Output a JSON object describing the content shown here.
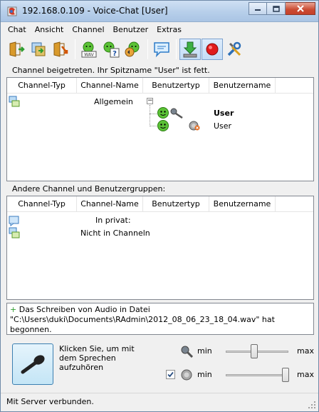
{
  "window": {
    "title": "192.168.0.109 - Voice-Chat [User]"
  },
  "menu": {
    "items": [
      "Chat",
      "Ansicht",
      "Channel",
      "Benutzer",
      "Extras"
    ]
  },
  "toolbar": {
    "buttons": [
      "join-channel-icon",
      "move-icon",
      "leave-icon",
      "user-wav-icon",
      "user-help-icon",
      "user-sound-icon",
      "chat-message-icon",
      "download-icon",
      "record-icon",
      "tools-icon"
    ]
  },
  "status_message": "Channel beigetreten. Ihr Spitzname \"User\" ist fett.",
  "channel_list": {
    "columns": [
      "Channel-Typ",
      "Channel-Name",
      "Benutzertyp",
      "Benutzername"
    ],
    "channel": {
      "name": "Allgemein",
      "expand_symbol": "−"
    },
    "users": [
      {
        "name": "User",
        "bold": true
      },
      {
        "name": "User",
        "bold": false
      }
    ]
  },
  "other_section": {
    "label": "Andere Channel und Benutzergruppen:",
    "columns": [
      "Channel-Typ",
      "Channel-Name",
      "Benutzertyp",
      "Benutzername"
    ],
    "rows": [
      "In privat:",
      "Nicht in Channeln"
    ]
  },
  "log": {
    "marker": "+",
    "text": "Das Schreiben von Audio in Datei \"C:\\Users\\duki\\Documents\\RAdmin\\2012_08_06_23_18_04.wav\" hat begonnen."
  },
  "voice": {
    "button_text": "Klicken Sie, um mit dem Sprechen aufzuhören",
    "mic_slider": {
      "min_label": "min",
      "max_label": "max",
      "level": 0.45
    },
    "speaker_slider": {
      "min_label": "min",
      "max_label": "max",
      "level": 0.95,
      "enabled": true
    }
  },
  "statusbar": {
    "text": "Mit Server verbunden."
  }
}
